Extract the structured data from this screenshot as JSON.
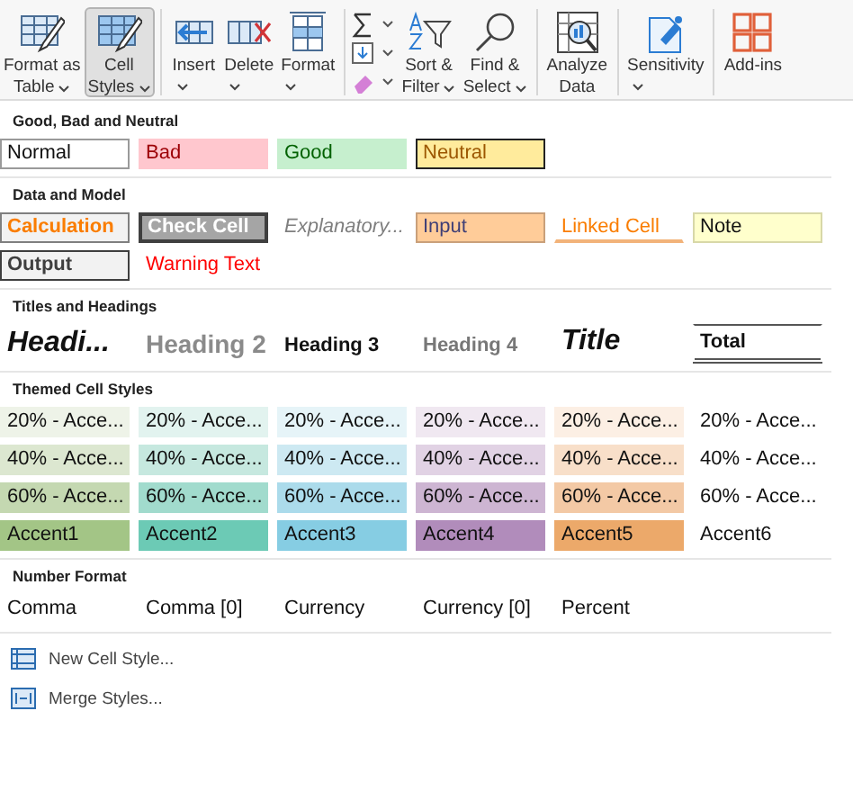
{
  "ribbon": {
    "buttons": [
      {
        "label": [
          "Format as",
          "Table"
        ],
        "selected": false
      },
      {
        "label": [
          "Cell",
          "Styles"
        ],
        "selected": true
      },
      {
        "label": [
          "Insert"
        ],
        "selected": false
      },
      {
        "label": [
          "Delete"
        ],
        "selected": false
      },
      {
        "label": [
          "Format"
        ],
        "selected": false
      },
      {
        "label": [
          "Sort &",
          "Filter"
        ],
        "selected": false
      },
      {
        "label": [
          "Find &",
          "Select"
        ],
        "selected": false
      },
      {
        "label": [
          "Analyze",
          "Data"
        ],
        "selected": false
      },
      {
        "label": [
          "Sensitivity"
        ],
        "selected": false
      },
      {
        "label": [
          "Add-ins"
        ],
        "selected": false
      }
    ]
  },
  "sections": [
    {
      "title": "Good, Bad and Neutral",
      "rows": [
        [
          {
            "text": "Normal",
            "kind": "normal"
          },
          {
            "text": "Bad",
            "kind": "bad"
          },
          {
            "text": "Good",
            "kind": "good"
          },
          {
            "text": "Neutral",
            "kind": "neutral"
          }
        ]
      ]
    },
    {
      "title": "Data and Model",
      "rows": [
        [
          {
            "text": "Calculation",
            "kind": "calculation"
          },
          {
            "text": "Check Cell",
            "kind": "check"
          },
          {
            "text": "Explanatory...",
            "kind": "explanatory"
          },
          {
            "text": "Input",
            "kind": "input"
          },
          {
            "text": "Linked Cell",
            "kind": "linked"
          },
          {
            "text": "Note",
            "kind": "note"
          }
        ],
        [
          {
            "text": "Output",
            "kind": "output"
          },
          {
            "text": "Warning Text",
            "kind": "warning"
          }
        ]
      ]
    },
    {
      "title": "Titles and Headings",
      "rows": [
        [
          {
            "text": "Headi...",
            "kind": "heading1"
          },
          {
            "text": "Heading 2",
            "kind": "heading2"
          },
          {
            "text": "Heading 3",
            "kind": "heading3"
          },
          {
            "text": "Heading 4",
            "kind": "heading4"
          },
          {
            "text": "Title",
            "kind": "title"
          },
          {
            "text": "Total",
            "kind": "total"
          }
        ]
      ]
    },
    {
      "title": "Themed Cell Styles",
      "rows": [
        [
          {
            "text": "20% - Acce...",
            "kind": "themed",
            "color": "#eef3e8"
          },
          {
            "text": "20% - Acce...",
            "kind": "themed",
            "color": "#e2f3ef"
          },
          {
            "text": "20% - Acce...",
            "kind": "themed",
            "color": "#e6f4f8"
          },
          {
            "text": "20% - Acce...",
            "kind": "themed",
            "color": "#f0e8f1"
          },
          {
            "text": "20% - Acce...",
            "kind": "themed",
            "color": "#fcefe4"
          },
          {
            "text": "20% - Acce...",
            "kind": "themed"
          }
        ],
        [
          {
            "text": "40% - Acce...",
            "kind": "themed",
            "color": "#dce7d0"
          },
          {
            "text": "40% - Acce...",
            "kind": "themed",
            "color": "#c6e8df"
          },
          {
            "text": "40% - Acce...",
            "kind": "themed",
            "color": "#cde9f2"
          },
          {
            "text": "40% - Acce...",
            "kind": "themed",
            "color": "#e1d2e4"
          },
          {
            "text": "40% - Acce...",
            "kind": "themed",
            "color": "#f8dfc9"
          },
          {
            "text": "40% - Acce...",
            "kind": "themed"
          }
        ],
        [
          {
            "text": "60% - Acce...",
            "kind": "themed",
            "color": "#c4d8b1"
          },
          {
            "text": "60% - Acce...",
            "kind": "themed",
            "color": "#a1dbcd"
          },
          {
            "text": "60% - Acce...",
            "kind": "themed",
            "color": "#abdbeb"
          },
          {
            "text": "60% - Acce...",
            "kind": "themed",
            "color": "#cdb5d2"
          },
          {
            "text": "60% - Acce...",
            "kind": "themed",
            "color": "#f3c9a5"
          },
          {
            "text": "60% - Acce...",
            "kind": "themed"
          }
        ],
        [
          {
            "text": "Accent1",
            "kind": "themed",
            "color": "#a3c586"
          },
          {
            "text": "Accent2",
            "kind": "themed",
            "color": "#6ccab5"
          },
          {
            "text": "Accent3",
            "kind": "themed",
            "color": "#86cde3"
          },
          {
            "text": "Accent4",
            "kind": "themed",
            "color": "#b18cbb"
          },
          {
            "text": "Accent5",
            "kind": "themed",
            "color": "#eca96a"
          },
          {
            "text": "Accent6",
            "kind": "themed"
          }
        ]
      ]
    },
    {
      "title": "Number Format",
      "rows": [
        [
          {
            "text": "Comma",
            "kind": "plain"
          },
          {
            "text": "Comma [0]",
            "kind": "plain"
          },
          {
            "text": "Currency",
            "kind": "plain"
          },
          {
            "text": "Currency [0]",
            "kind": "plain"
          },
          {
            "text": "Percent",
            "kind": "plain"
          }
        ]
      ]
    }
  ],
  "menu": [
    {
      "label": "New Cell Style..."
    },
    {
      "label": "Merge Styles..."
    }
  ]
}
